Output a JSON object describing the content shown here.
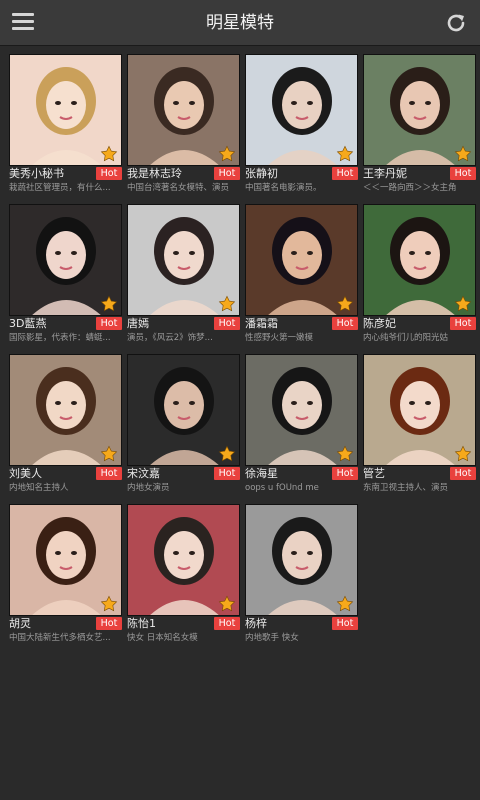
{
  "header": {
    "title": "明星模特"
  },
  "cards": [
    {
      "name": "美秀小秘书",
      "hot": "Hot",
      "desc": "栽蔬社区管理员，有什么...",
      "bg": "#f1d7c9",
      "hair": "#caa05a",
      "skin": "#f6e0cf"
    },
    {
      "name": "我是林志玲",
      "hot": "Hot",
      "desc": "中国台湾著名女模特、演员",
      "bg": "#8a7466",
      "hair": "#3a2a22",
      "skin": "#e9c9b2"
    },
    {
      "name": "张静初",
      "hot": "Hot",
      "desc": "中国著名电影演员。",
      "bg": "#cfd6dd",
      "hair": "#1b1b1b",
      "skin": "#e8d1c2"
    },
    {
      "name": "王李丹妮",
      "hot": "Hot",
      "desc": "＜＜一路向西＞＞女主角",
      "bg": "#6b8063",
      "hair": "#2a1e18",
      "skin": "#e8c7b3"
    },
    {
      "name": "3D藍燕",
      "hot": "Hot",
      "desc": "国际影星，代表作：蜻蜓...",
      "bg": "#2e2a2a",
      "hair": "#121212",
      "skin": "#efd6cc"
    },
    {
      "name": "唐嫣",
      "hot": "Hot",
      "desc": "演员，《风云2》饰梦...",
      "bg": "#c9c9c9",
      "hair": "#2b2222",
      "skin": "#f0d9cd"
    },
    {
      "name": "潘霜霜",
      "hot": "Hot",
      "desc": "性感野火第一嫩模",
      "bg": "#5a3a2a",
      "hair": "#151018",
      "skin": "#e2b89b"
    },
    {
      "name": "陈彦妃",
      "hot": "Hot",
      "desc": "内心纯爷们儿的阳光姑",
      "bg": "#3f6a3a",
      "hair": "#1c1512",
      "skin": "#efcdbb"
    },
    {
      "name": "刘美人",
      "hot": "Hot",
      "desc": "内地知名主持人",
      "bg": "#a28b78",
      "hair": "#4a2e1e",
      "skin": "#f1d8c6"
    },
    {
      "name": "宋汶嘉",
      "hot": "Hot",
      "desc": "内地女演员",
      "bg": "#2b2b2b",
      "hair": "#141414",
      "skin": "#dcbca8"
    },
    {
      "name": "徐海星",
      "hot": "Hot",
      "desc": "oops u fOUnd me",
      "bg": "#6c6c64",
      "hair": "#161616",
      "skin": "#e9d4c6"
    },
    {
      "name": "管艺",
      "hot": "Hot",
      "desc": "东南卫视主持人、演员",
      "bg": "#b9a98f",
      "hair": "#6b2a12",
      "skin": "#f3dacb"
    },
    {
      "name": "胡灵",
      "hot": "Hot",
      "desc": "中国大陆新生代多栖女艺...",
      "bg": "#d9b6a6",
      "hair": "#3a2014",
      "skin": "#f0d3c2"
    },
    {
      "name": "陈怡1",
      "hot": "Hot",
      "desc": "快女 日本知名女模",
      "bg": "#b14a52",
      "hair": "#2a2320",
      "skin": "#f1d9cc"
    },
    {
      "name": "杨梓",
      "hot": "Hot",
      "desc": "内地歌手 快女",
      "bg": "#9a9a9a",
      "hair": "#1a1a1a",
      "skin": "#ead2c4"
    }
  ]
}
